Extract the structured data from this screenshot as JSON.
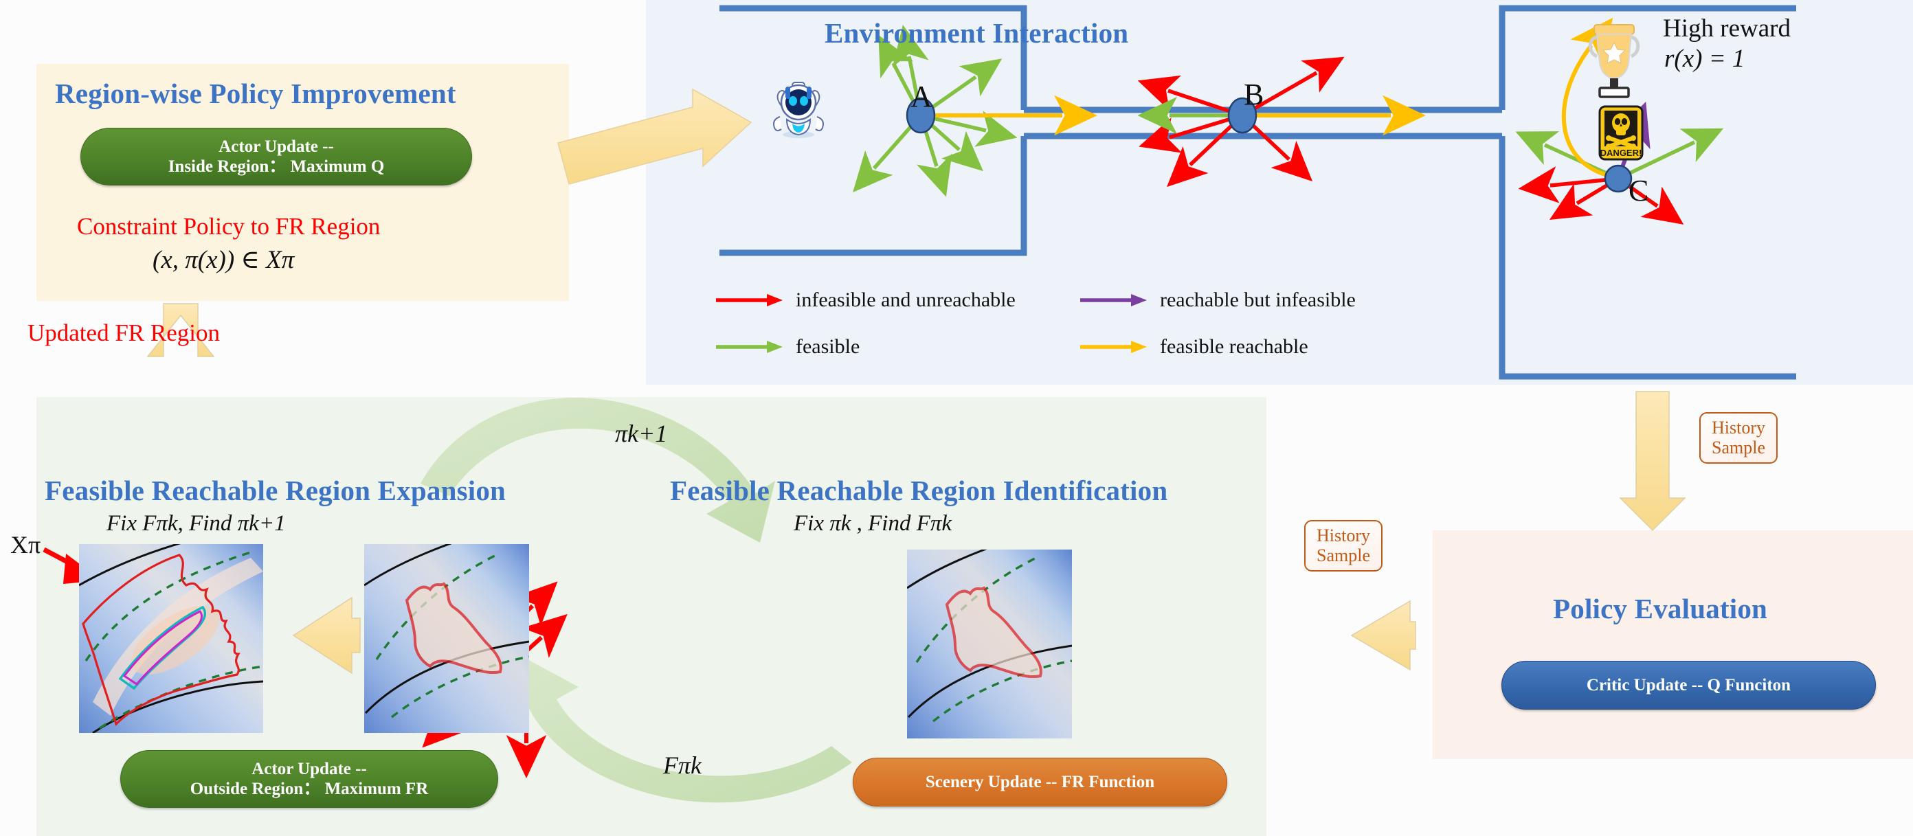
{
  "panels": {
    "improvement": {
      "title": "Region-wise Policy Improvement",
      "bg": "#fdf4e0"
    },
    "environment": {
      "title": "Environment Interaction",
      "bg": "#eef3f9"
    },
    "cycle": {
      "bg": "#eff5ec"
    },
    "evaluation": {
      "title": "Policy Evaluation",
      "bg": "#fbf0ea"
    }
  },
  "improvement": {
    "actor_pill_line1": "Actor Update --",
    "actor_pill_line2": "Inside Region：  Maximum Q",
    "constraint_text": "Constraint Policy to FR Region",
    "constraint_math": "(x, π(x))  ∈  Xπ",
    "updated_fr_label": "Updated FR Region",
    "pill_color": "#4e8329",
    "title_color": "#3d73c4",
    "annotation_color": "#ff0000"
  },
  "environment": {
    "title": "Environment Interaction",
    "nodes": [
      {
        "label": "A",
        "kind": "all-feasible"
      },
      {
        "label": "B",
        "kind": "mostly-infeasible"
      },
      {
        "label": "C",
        "kind": "mixed"
      }
    ],
    "robot_icon": "robot-icon",
    "trophy_icon": "trophy-icon",
    "danger_icon": "danger-skull-icon",
    "danger_sign_text": "DANGER!",
    "high_reward_label": "High reward",
    "reward_math": "r(x) = 1"
  },
  "legend": {
    "items": [
      {
        "label": "infeasible and unreachable",
        "color": "#ff0000",
        "icon": "arrow-right-icon"
      },
      {
        "label": "reachable but infeasible",
        "color": "#7b3fa0",
        "icon": "arrow-right-icon"
      },
      {
        "label": "feasible",
        "color": "#85c141",
        "icon": "arrow-right-icon"
      },
      {
        "label": "feasible reachable",
        "color": "#ffc000",
        "icon": "arrow-right-icon"
      }
    ]
  },
  "cycle": {
    "expansion": {
      "title": "Feasible Reachable Region Expansion",
      "subtitle": "Fix Fπk,  Find πk+1",
      "xpi_label": "Xπ",
      "actor_pill_line1": "Actor Update --",
      "actor_pill_line2": "Outside Region：  Maximum FR"
    },
    "identification": {
      "title": "Feasible Reachable Region Identification",
      "subtitle": "Fix πk ,  Find Fπk",
      "scenery_pill": "Scenery Update -- FR Function"
    },
    "arrow_top_label": "πk+1",
    "arrow_bottom_label": "Fπk",
    "arrow_color": "#cfe2c0"
  },
  "evaluation": {
    "title": "Policy Evaluation",
    "critic_pill": "Critic Update -- Q Funciton",
    "pill_color": "#3568ad"
  },
  "history_tags": [
    {
      "line1": "History",
      "line2": "Sample"
    },
    {
      "line1": "History",
      "line2": "Sample"
    }
  ],
  "colors": {
    "blue_heading": "#3d73c4",
    "panel_border_blue": "#4a7ec0",
    "yellow_arrow": "#fadf9a",
    "green_arrow": "#cfe2c0",
    "orange_tag": "#c25a18",
    "red": "#ff0000",
    "green_line": "#85c141",
    "purple": "#7b3fa0",
    "gold": "#ffc000"
  }
}
